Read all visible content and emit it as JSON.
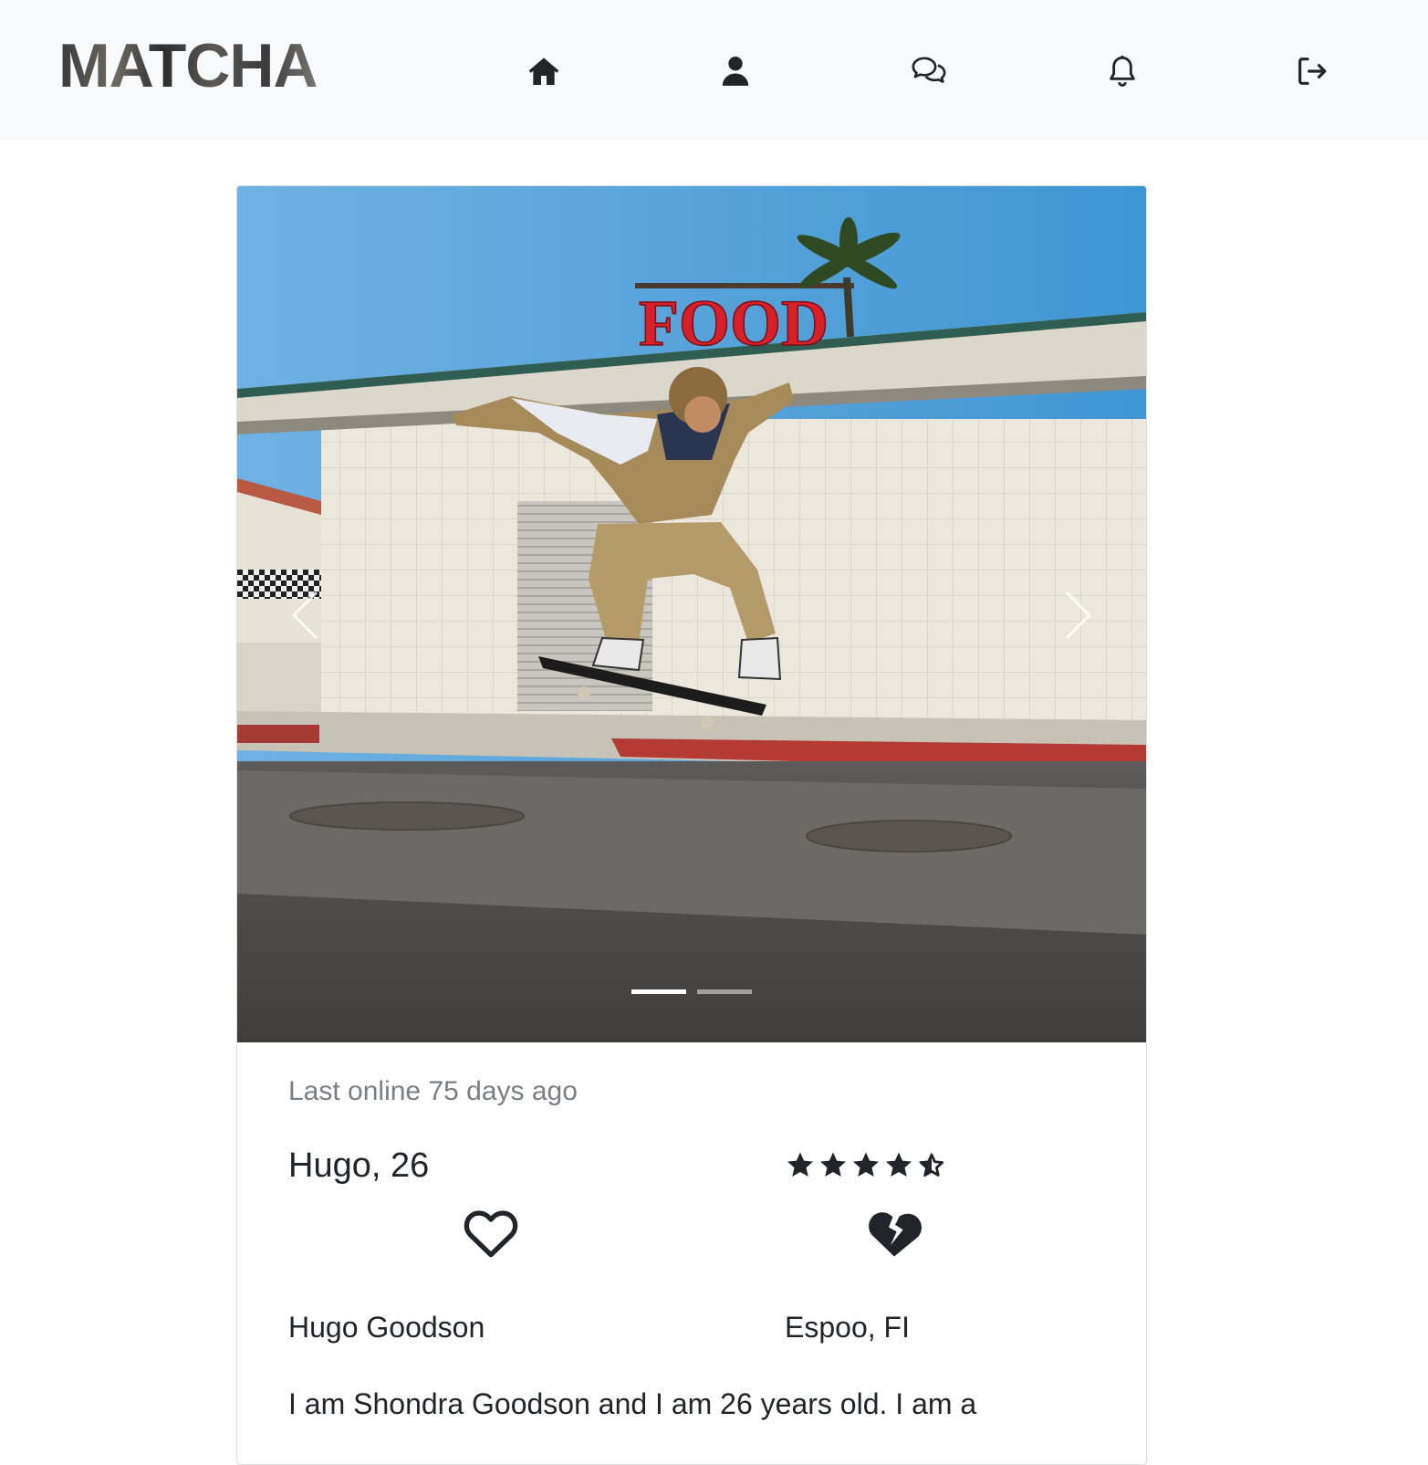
{
  "app": {
    "brand": "MATCHA"
  },
  "nav": {
    "items": [
      {
        "name": "home",
        "icon": "home-icon"
      },
      {
        "name": "profile",
        "icon": "user-icon"
      },
      {
        "name": "chat",
        "icon": "chat-icon"
      },
      {
        "name": "notifications",
        "icon": "bell-icon"
      },
      {
        "name": "logout",
        "icon": "logout-icon"
      }
    ]
  },
  "profile": {
    "last_online": "Last online 75 days ago",
    "name_age": "Hugo, 26",
    "rating": 4.5,
    "rating_max": 5,
    "full_name": "Hugo Goodson",
    "location": "Espoo, FI",
    "bio": "I am Shondra Goodson and I am 26 years old. I am a"
  },
  "carousel": {
    "slide_count": 2,
    "active_slide": 1,
    "photo_sign_text": "FOOD"
  },
  "colors": {
    "navbar_bg": "#f8f9fa",
    "text": "#212529",
    "muted": "#7b7f83"
  }
}
